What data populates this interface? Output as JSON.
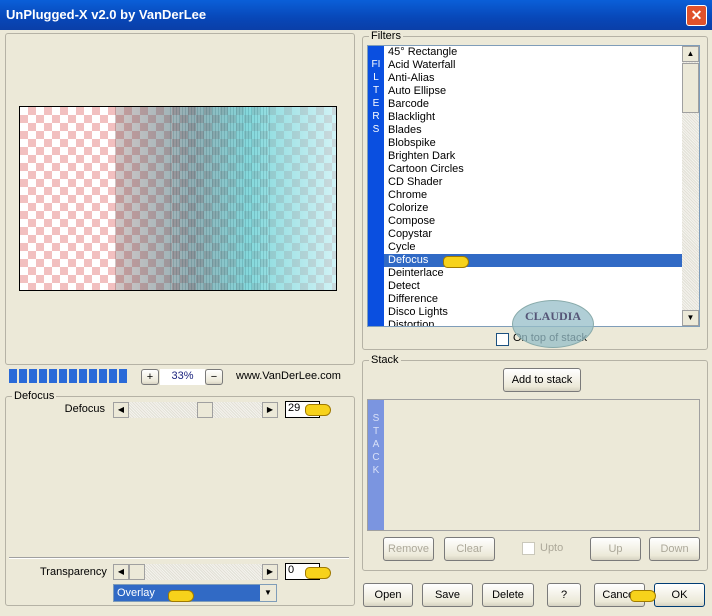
{
  "window": {
    "title": "UnPlugged-X v2.0 by VanDerLee",
    "close_icon": "close-icon"
  },
  "preview": {
    "zoom": "33%",
    "zoom_in": "+",
    "zoom_out": "−",
    "website": "www.VanDerLee.com",
    "progress_segments": 12
  },
  "params": {
    "group_title": "Defocus",
    "defocus": {
      "label": "Defocus",
      "value": "29",
      "slider_fraction": 0.6
    },
    "transparency": {
      "label": "Transparency",
      "value": "0",
      "slider_fraction": 0.0
    },
    "blend_mode": "Overlay"
  },
  "filters": {
    "group_title": "Filters",
    "side_label": "FILTERS",
    "selected": "Defocus",
    "items": [
      "45° Rectangle",
      "Acid Waterfall",
      "Anti-Alias",
      "Auto Ellipse",
      "Barcode",
      "Blacklight",
      "Blades",
      "Blobspike",
      "Brighten Dark",
      "Cartoon Circles",
      "CD Shader",
      "Chrome",
      "Colorize",
      "Compose",
      "Copystar",
      "Cycle",
      "Defocus",
      "Deinterlace",
      "Detect",
      "Difference",
      "Disco Lights",
      "Distortion"
    ],
    "on_top_of_stack": "On top of stack",
    "watermark": "CLAUDIA"
  },
  "stack": {
    "group_title": "Stack",
    "side_label": "STACK",
    "add": "Add to stack",
    "remove": "Remove",
    "clear": "Clear",
    "upto": "Upto",
    "up": "Up",
    "down": "Down"
  },
  "footer": {
    "open": "Open",
    "save": "Save",
    "delete": "Delete",
    "help": "?",
    "cancel": "Cancel",
    "ok": "OK"
  },
  "colors": {
    "accent": "#316ac5",
    "sidebar": "#0a4fe0"
  }
}
